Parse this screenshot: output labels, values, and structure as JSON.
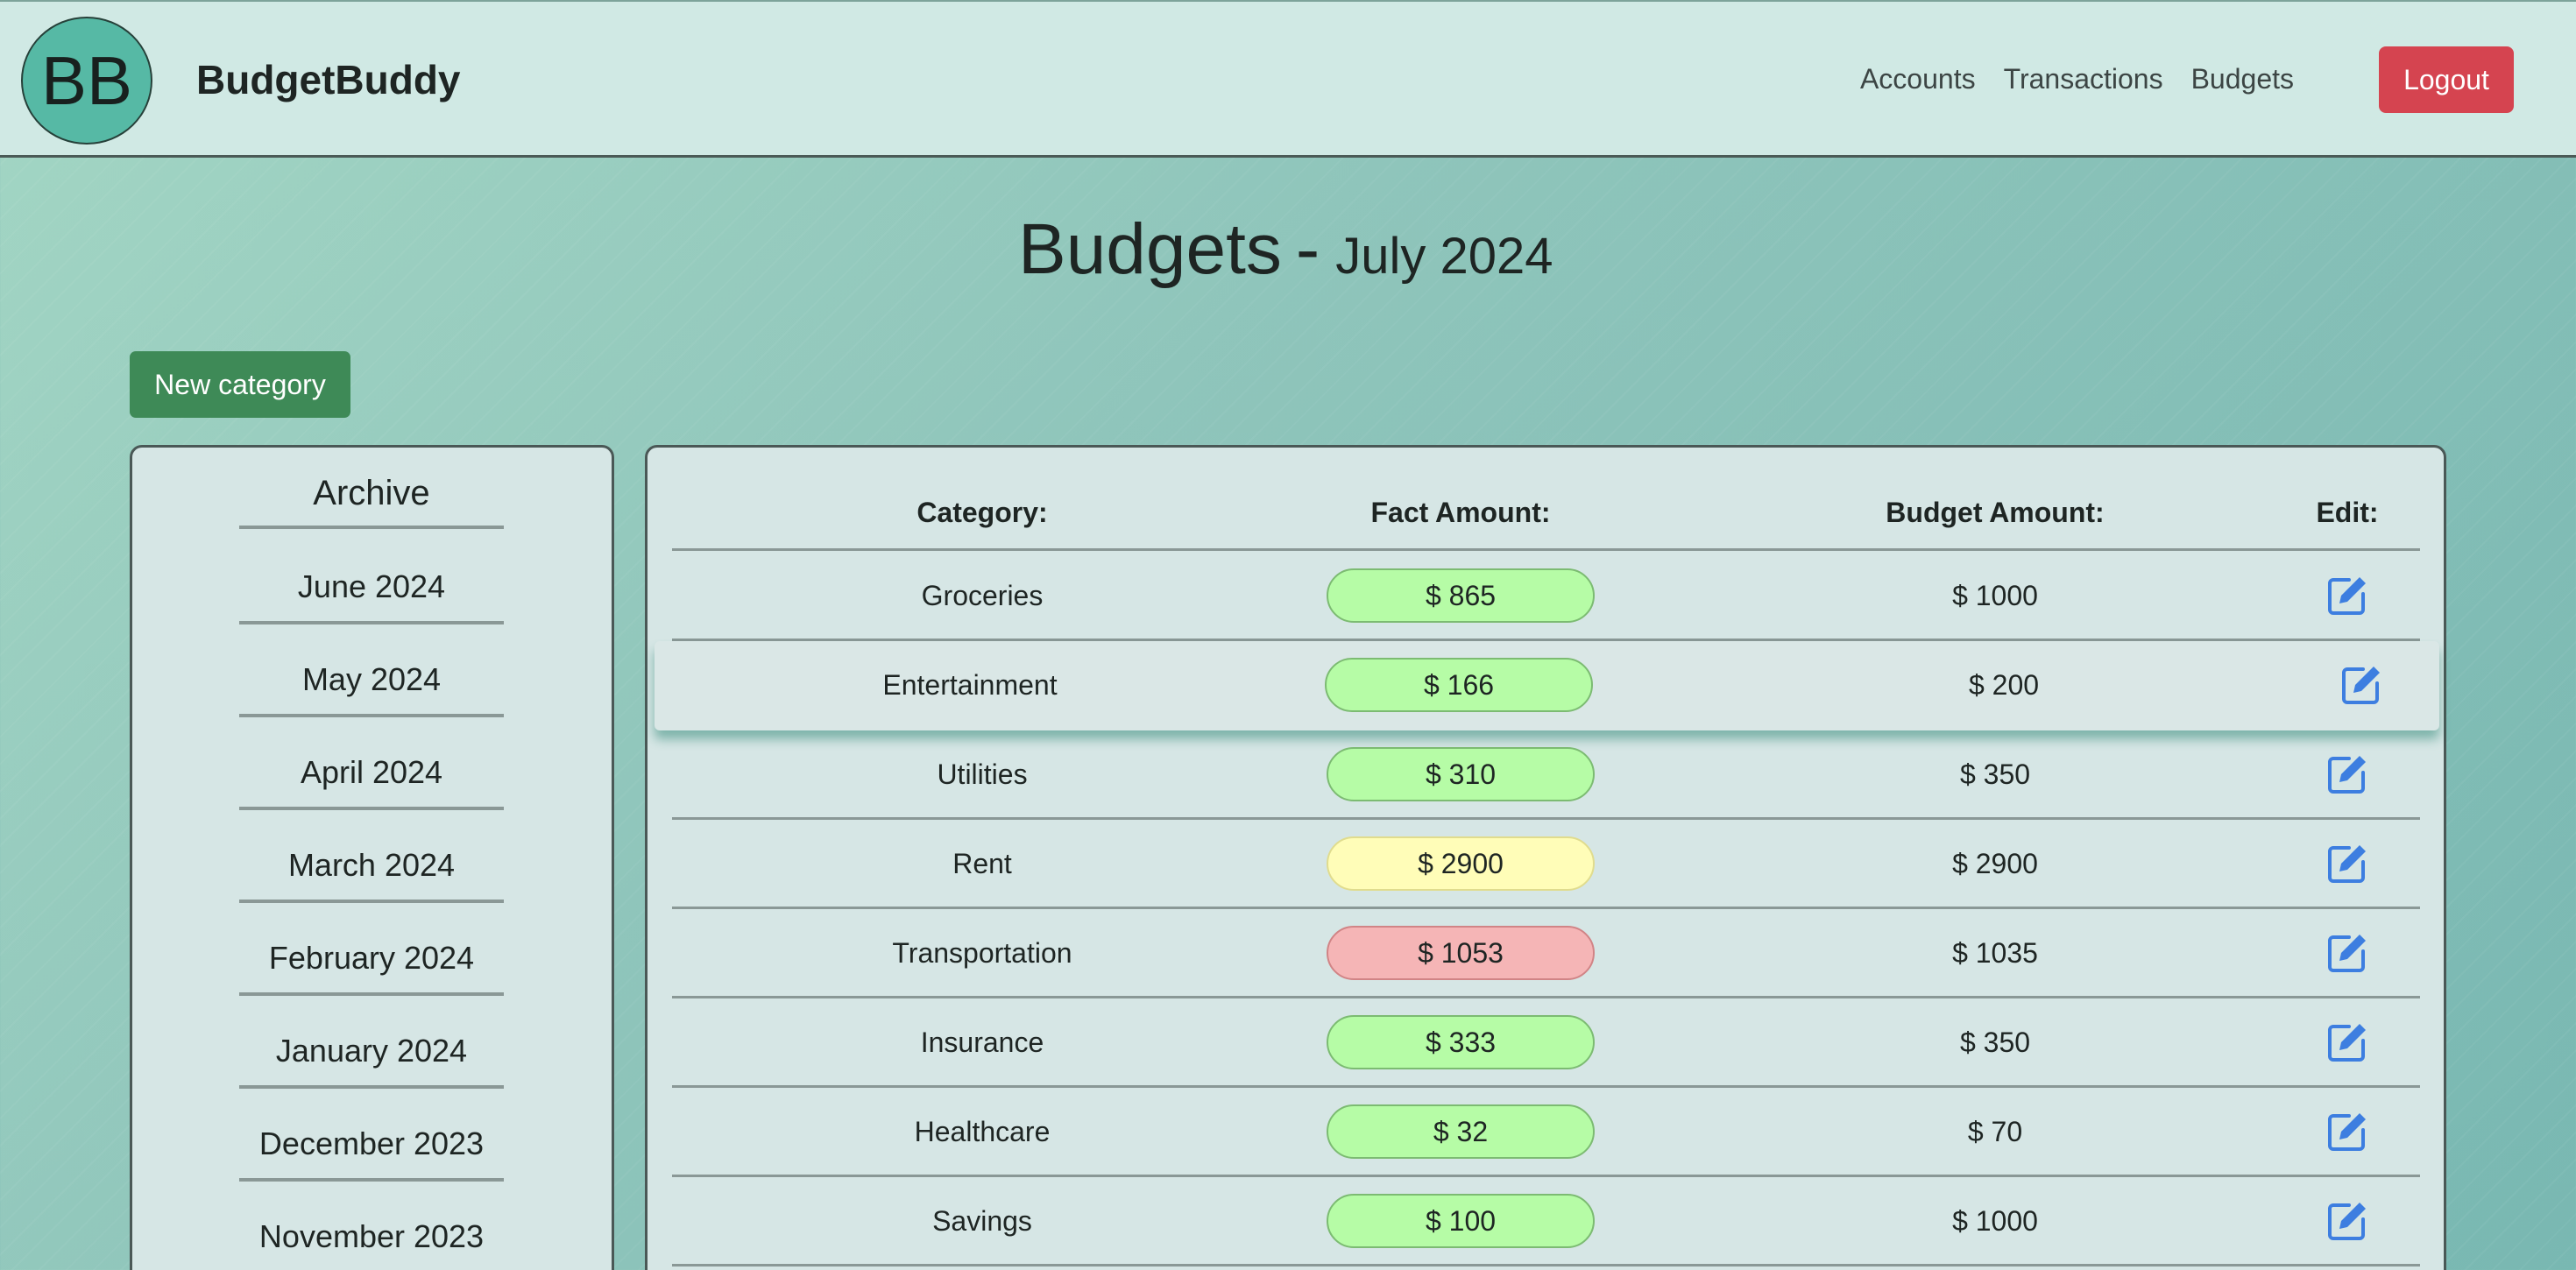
{
  "navbar": {
    "logo_text": "BB",
    "brand": "BudgetBuddy",
    "links": [
      "Accounts",
      "Transactions",
      "Budgets"
    ],
    "logout_label": "Logout"
  },
  "page": {
    "title": "Budgets",
    "separator": "-",
    "month": "July 2024",
    "new_category_label": "New category"
  },
  "archive": {
    "title": "Archive",
    "items": [
      "June 2024",
      "May 2024",
      "April 2024",
      "March 2024",
      "February 2024",
      "January 2024",
      "December 2023",
      "November 2023"
    ]
  },
  "table": {
    "headers": {
      "category": "Category:",
      "fact": "Fact Amount:",
      "budget": "Budget Amount:",
      "edit": "Edit:"
    },
    "rows": [
      {
        "category": "Groceries",
        "fact": "$ 865",
        "budget": "$ 1000",
        "status": "green"
      },
      {
        "category": "Entertainment",
        "fact": "$ 166",
        "budget": "$ 200",
        "status": "green"
      },
      {
        "category": "Utilities",
        "fact": "$ 310",
        "budget": "$ 350",
        "status": "green"
      },
      {
        "category": "Rent",
        "fact": "$ 2900",
        "budget": "$ 2900",
        "status": "yellow"
      },
      {
        "category": "Transportation",
        "fact": "$ 1053",
        "budget": "$ 1035",
        "status": "red"
      },
      {
        "category": "Insurance",
        "fact": "$ 333",
        "budget": "$ 350",
        "status": "green"
      },
      {
        "category": "Healthcare",
        "fact": "$ 32",
        "budget": "$ 70",
        "status": "green"
      },
      {
        "category": "Savings",
        "fact": "$ 100",
        "budget": "$ 1000",
        "status": "green"
      }
    ]
  },
  "colors": {
    "accent": "#56b9a5",
    "logout": "#d54450",
    "new_category": "#3e8a57",
    "edit_icon": "#3d7ee0",
    "under_budget": "#b6fca6",
    "on_budget": "#fffdb8",
    "over_budget": "#f5b5b6"
  },
  "icons": {
    "edit": "edit-square-pencil-icon"
  }
}
